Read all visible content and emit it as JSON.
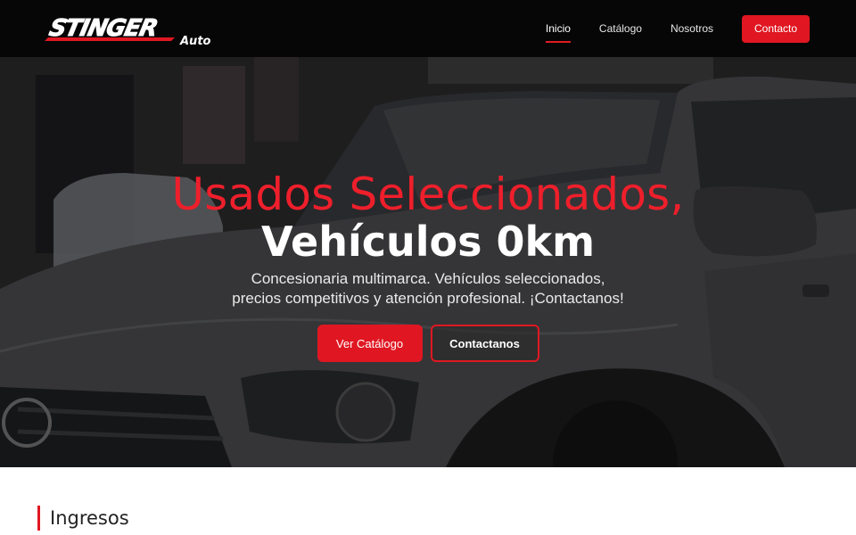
{
  "brand": {
    "logo_main": "STINGER",
    "logo_sub": "Auto",
    "accent_color": "#e01722"
  },
  "nav": {
    "items": [
      {
        "label": "Inicio",
        "active": true
      },
      {
        "label": "Catálogo",
        "active": false
      },
      {
        "label": "Nosotros",
        "active": false
      }
    ],
    "cta_label": "Contacto"
  },
  "hero": {
    "title_line1": "Usados Seleccionados,",
    "title_line2": "Vehículos 0km",
    "subtitle": "Concesionaria multimarca. Vehículos seleccionados, precios competitivos y atención profesional. ¡Contactanos!",
    "primary_button": "Ver Catálogo",
    "secondary_button": "Contactanos"
  },
  "section": {
    "title": "Ingresos"
  }
}
